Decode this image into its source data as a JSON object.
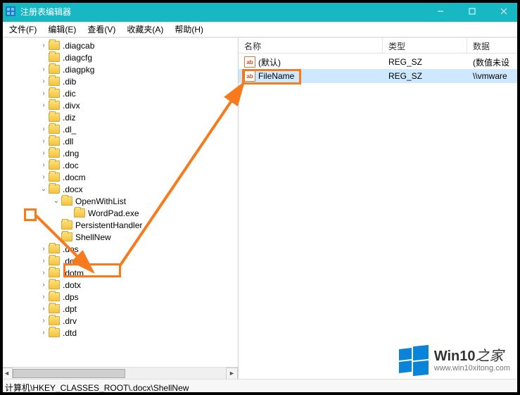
{
  "window": {
    "title": "注册表编辑器"
  },
  "menu": {
    "file": "文件(F)",
    "edit": "编辑(E)",
    "view": "查看(V)",
    "favorites": "收藏夹(A)",
    "help": "帮助(H)"
  },
  "tree": {
    "items": [
      {
        "indent": 3,
        "exp": ">",
        "label": ".diagcab"
      },
      {
        "indent": 3,
        "exp": "",
        "label": ".diagcfg"
      },
      {
        "indent": 3,
        "exp": ">",
        "label": ".diagpkg"
      },
      {
        "indent": 3,
        "exp": ">",
        "label": ".dib"
      },
      {
        "indent": 3,
        "exp": ">",
        "label": ".dic"
      },
      {
        "indent": 3,
        "exp": ">",
        "label": ".divx"
      },
      {
        "indent": 3,
        "exp": "",
        "label": ".diz"
      },
      {
        "indent": 3,
        "exp": ">",
        "label": ".dl_"
      },
      {
        "indent": 3,
        "exp": ">",
        "label": ".dll"
      },
      {
        "indent": 3,
        "exp": ">",
        "label": ".dng"
      },
      {
        "indent": 3,
        "exp": ">",
        "label": ".doc"
      },
      {
        "indent": 3,
        "exp": ">",
        "label": ".docm"
      },
      {
        "indent": 3,
        "exp": "v",
        "label": ".docx",
        "hl": "exp"
      },
      {
        "indent": 4,
        "exp": "v",
        "label": "OpenWithList"
      },
      {
        "indent": 5,
        "exp": "",
        "label": "WordPad.exe"
      },
      {
        "indent": 4,
        "exp": "",
        "label": "PersistentHandler"
      },
      {
        "indent": 4,
        "exp": "",
        "label": "ShellNew",
        "hl": "row"
      },
      {
        "indent": 3,
        "exp": ">",
        "label": ".dos"
      },
      {
        "indent": 3,
        "exp": ">",
        "label": ".dot"
      },
      {
        "indent": 3,
        "exp": ">",
        "label": ".dotm"
      },
      {
        "indent": 3,
        "exp": ">",
        "label": ".dotx"
      },
      {
        "indent": 3,
        "exp": ">",
        "label": ".dps"
      },
      {
        "indent": 3,
        "exp": ">",
        "label": ".dpt"
      },
      {
        "indent": 3,
        "exp": ">",
        "label": ".drv"
      },
      {
        "indent": 3,
        "exp": ">",
        "label": ".dtd"
      }
    ]
  },
  "list": {
    "headers": {
      "name": "名称",
      "type": "类型",
      "data": "数据"
    },
    "rows": [
      {
        "name": "(默认)",
        "type": "REG_SZ",
        "data": "(数值未设",
        "sel": false
      },
      {
        "name": "FileName",
        "type": "REG_SZ",
        "data": "\\\\vmware",
        "sel": true,
        "hl": true
      }
    ]
  },
  "status": {
    "path": "计算机\\HKEY_CLASSES_ROOT\\.docx\\ShellNew"
  },
  "watermark": {
    "brand_bold": "Win10",
    "brand_rest": "之家",
    "url": "www.win10xitong.com"
  }
}
